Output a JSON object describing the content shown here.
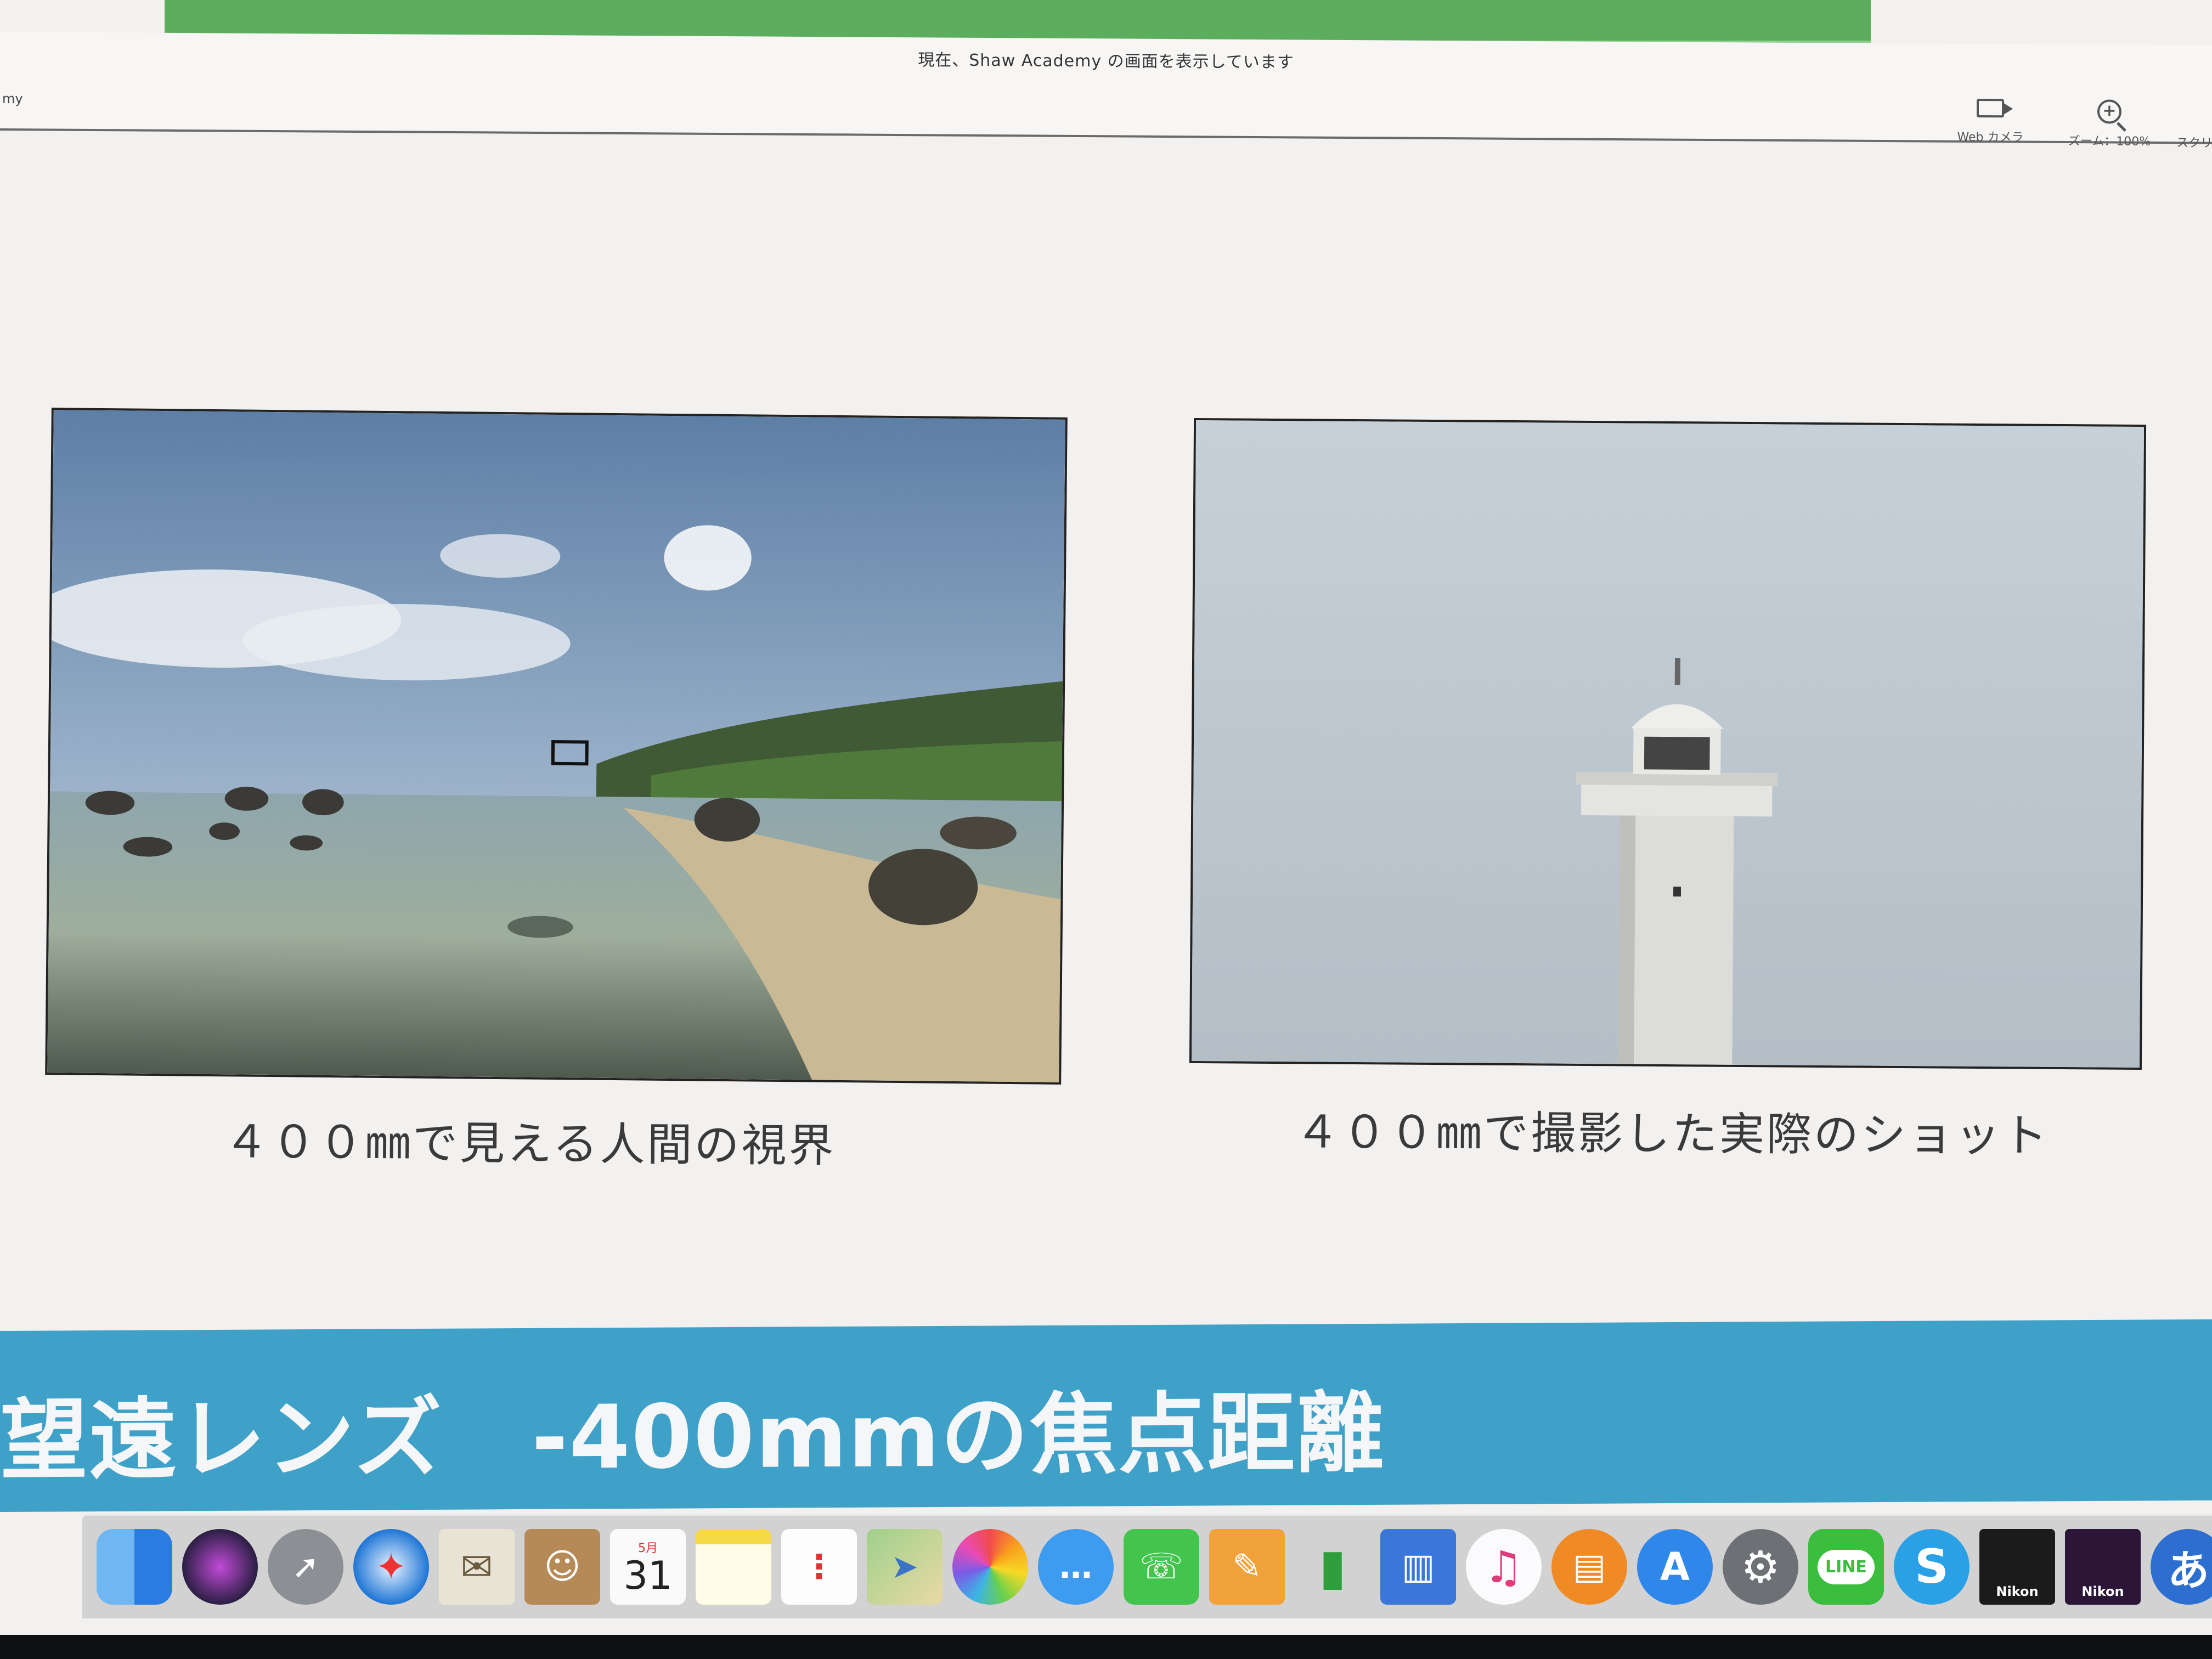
{
  "share_bar": {
    "notice": "現在、Shaw Academy の画面を表示しています",
    "crumb": "my",
    "webcam_label": "Web カメラ",
    "zoom_label": "ズーム：100%",
    "screen_label": "スクリ"
  },
  "slide": {
    "left_caption": "４００㎜で見える人間の視界",
    "right_caption": "４００㎜で撮影した実際のショット",
    "title": "望遠レンズ　-400mmの焦点距離"
  },
  "dock": {
    "calendar_month": "5月",
    "calendar_day": "31",
    "line_label": "LINE",
    "nikon_label_1": "Nikon",
    "nikon_label_2": "Nikon",
    "ime_label": "あ",
    "icons": [
      "finder-icon",
      "siri-icon",
      "launchpad-icon",
      "safari-icon",
      "mail-icon",
      "contacts-icon",
      "calendar-icon",
      "notes-icon",
      "reminders-icon",
      "maps-icon",
      "photos-icon",
      "messages-icon",
      "facetime-icon",
      "pages-icon",
      "numbers-icon",
      "keynote-icon",
      "itunes-icon",
      "ibooks-icon",
      "app-store-icon",
      "system-preferences-icon",
      "line-icon",
      "skype-icon",
      "nikon-viewnx-icon",
      "nikon-capture-icon",
      "input-method-icon",
      "extra-app-icon"
    ]
  },
  "colors": {
    "banner": "#3fa0c8",
    "green_strip": "#5cae5e",
    "slide_bg": "#f3f1ef"
  }
}
